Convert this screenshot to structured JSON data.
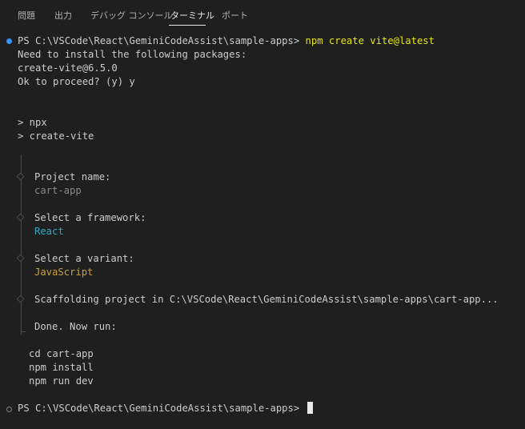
{
  "tabs": [
    {
      "label": "問題",
      "active": false
    },
    {
      "label": "出力",
      "active": false
    },
    {
      "label": "デバッグ コンソール",
      "active": false
    },
    {
      "label": "ターミナル",
      "active": true
    },
    {
      "label": "ポート",
      "active": false
    }
  ],
  "terminal": {
    "prompt1": "PS C:\\VSCode\\React\\GeminiCodeAssist\\sample-apps>",
    "command1": "npm create vite@latest",
    "need_install": "Need to install the following packages:",
    "package": "create-vite@6.5.0",
    "proceed": "Ok to proceed? (y) y",
    "npx": "> npx",
    "create_vite": "> create-vite",
    "project_name_label": "Project name:",
    "project_name_value": "cart-app",
    "framework_label": "Select a framework:",
    "framework_value": "React",
    "variant_label": "Select a variant:",
    "variant_value": "JavaScript",
    "scaffolding": "Scaffolding project in C:\\VSCode\\React\\GeminiCodeAssist\\sample-apps\\cart-app...",
    "done": "Done. Now run:",
    "run_cmds": [
      "cd cart-app",
      "npm install",
      "npm run dev"
    ],
    "prompt2": "PS C:\\VSCode\\React\\GeminiCodeAssist\\sample-apps>"
  },
  "colors": {
    "background": "#1f1f1f",
    "command": "#e5e510",
    "value_grey": "#8a8a8a",
    "framework_cyan": "#2fa7c4",
    "variant_yellow": "#c8a23c",
    "status_dot": "#3794ff"
  }
}
